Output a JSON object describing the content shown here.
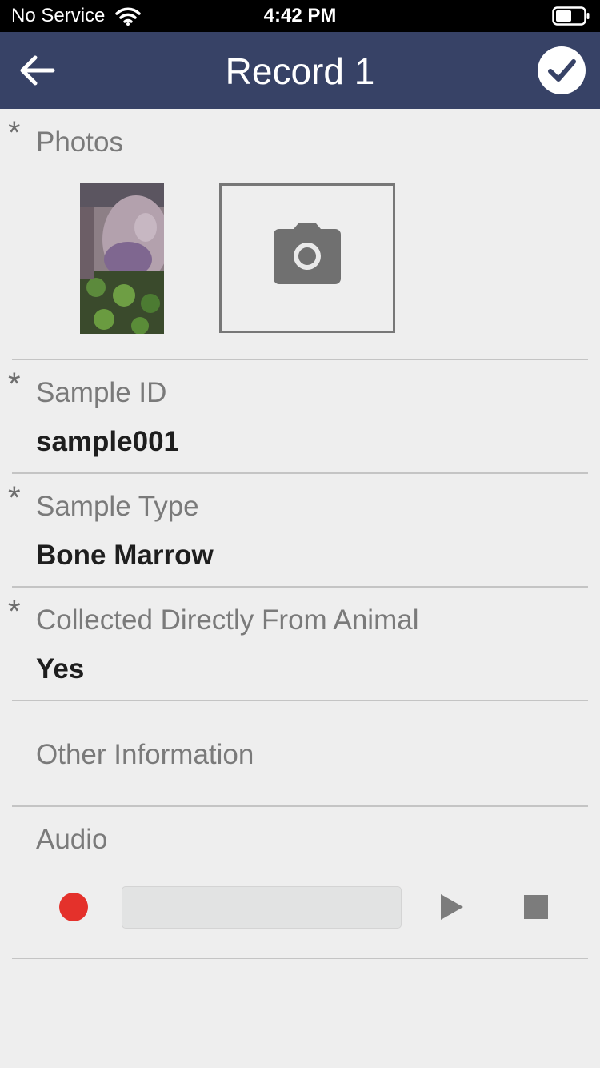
{
  "status_bar": {
    "carrier": "No Service",
    "time": "4:42 PM"
  },
  "header": {
    "title": "Record 1"
  },
  "required_marker": "*",
  "photos": {
    "label": "Photos"
  },
  "fields": [
    {
      "label": "Sample ID",
      "value": "sample001",
      "required": true
    },
    {
      "label": "Sample Type",
      "value": "Bone Marrow",
      "required": true
    },
    {
      "label": "Collected Directly From Animal",
      "value": "Yes",
      "required": true
    },
    {
      "label": "Other Information",
      "value": "",
      "required": false
    }
  ],
  "audio": {
    "label": "Audio"
  },
  "colors": {
    "nav_bar": "#374266",
    "record": "#e4312b",
    "controls": "#7c7c7c"
  },
  "icons": {
    "back": "arrow-left-icon",
    "confirm": "check-circle-icon",
    "camera": "camera-icon",
    "record": "record-icon",
    "play": "play-icon",
    "stop": "stop-icon"
  }
}
